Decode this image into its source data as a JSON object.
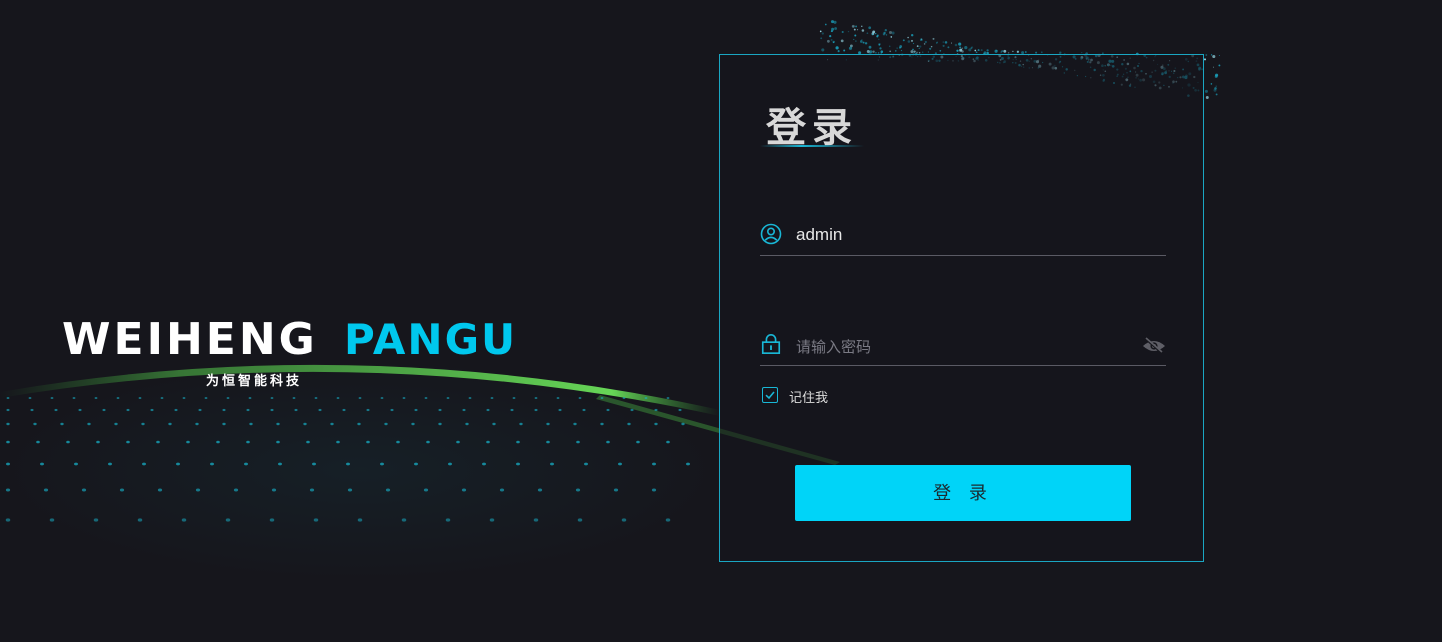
{
  "brand": {
    "name": "WEIHENG",
    "product": "PANGU",
    "subtitle": "为恒智能科技"
  },
  "login": {
    "title": "登录",
    "username_value": "admin",
    "password_placeholder": "请输入密码",
    "remember_label": "记住我",
    "remember_checked": true,
    "submit_label": "登 录"
  },
  "colors": {
    "accent": "#00d4f8",
    "panel_border": "#1aa6c2",
    "background": "#16161c"
  },
  "icons": {
    "user": "user-circle-icon",
    "password": "lock-icon",
    "toggle_visibility": "eye-off-icon",
    "checkbox": "checkmark-icon"
  }
}
